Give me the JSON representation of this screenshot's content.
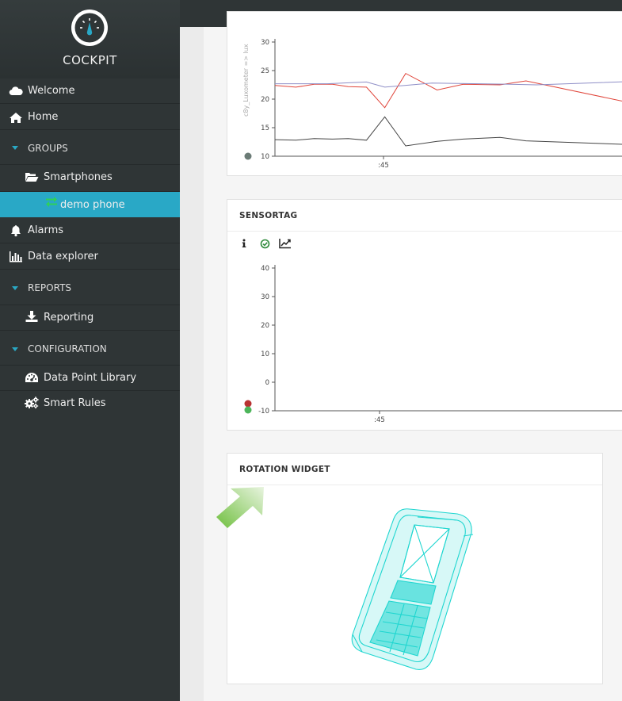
{
  "app": {
    "name": "COCKPIT",
    "logo_icon": "gauge-icon",
    "accent": "#29a8c6"
  },
  "sidebar": {
    "items": [
      {
        "label": "Welcome",
        "icon": "cloud-icon"
      },
      {
        "label": "Home",
        "icon": "home-icon"
      },
      {
        "label": "GROUPS",
        "icon": "caret-down-icon"
      },
      {
        "label": "Smartphones",
        "icon": "folder-open-icon"
      },
      {
        "label": "demo phone",
        "icon": "exchange-icon",
        "active": true
      },
      {
        "label": "Alarms",
        "icon": "bell-icon"
      },
      {
        "label": "Data explorer",
        "icon": "bar-chart-icon"
      },
      {
        "label": "REPORTS",
        "icon": "caret-down-icon"
      },
      {
        "label": "Reporting",
        "icon": "download-icon"
      },
      {
        "label": "CONFIGURATION",
        "icon": "caret-down-icon"
      },
      {
        "label": "Data Point Library",
        "icon": "dashboard-icon"
      },
      {
        "label": "Smart Rules",
        "icon": "cogs-icon"
      }
    ]
  },
  "widgets": {
    "luxometer": {
      "y_axis_title": "c8y_Luxometer => lux",
      "legend_dot_color": "#6b7b76"
    },
    "sensortag": {
      "title": "SENSORTAG",
      "toolbar": [
        "info-icon",
        "check-circle-icon",
        "line-chart-icon"
      ],
      "legend_dot_colors": [
        "#b83232",
        "#4cb55a"
      ]
    },
    "rotation": {
      "title": "ROTATION WIDGET",
      "model_color": "#1fd6d0",
      "arrow_icon": "green-arrow-icon"
    }
  },
  "chart_data": [
    {
      "type": "line",
      "ylabel": "c8y_Luxometer => lux",
      "ylim": [
        10,
        30
      ],
      "yticks": [
        "10",
        "15",
        "20",
        "25",
        "30"
      ],
      "xticks": [
        ":45"
      ],
      "series": [
        {
          "color": "#e0453a",
          "points": [
            [
              0,
              22.4
            ],
            [
              0.08,
              22.1
            ],
            [
              0.15,
              22.6
            ],
            [
              0.22,
              22.6
            ],
            [
              0.28,
              22.2
            ],
            [
              0.35,
              22.1
            ],
            [
              0.42,
              18.5
            ],
            [
              0.5,
              24.5
            ],
            [
              0.62,
              21.6
            ],
            [
              0.72,
              22.6
            ],
            [
              0.86,
              22.5
            ],
            [
              0.96,
              23.2
            ],
            [
              1.5,
              18
            ]
          ]
        },
        {
          "color": "#8f8fc7",
          "points": [
            [
              0,
              22.7
            ],
            [
              0.2,
              22.7
            ],
            [
              0.35,
              23.0
            ],
            [
              0.42,
              22.1
            ],
            [
              0.6,
              22.8
            ],
            [
              0.9,
              22.6
            ],
            [
              1.0,
              22.5
            ],
            [
              1.5,
              23.3
            ]
          ]
        },
        {
          "color": "#444444",
          "points": [
            [
              0,
              12.9
            ],
            [
              0.08,
              12.8
            ],
            [
              0.15,
              13.1
            ],
            [
              0.22,
              13.0
            ],
            [
              0.28,
              13.1
            ],
            [
              0.35,
              12.8
            ],
            [
              0.42,
              16.9
            ],
            [
              0.5,
              11.8
            ],
            [
              0.62,
              12.6
            ],
            [
              0.72,
              13.0
            ],
            [
              0.86,
              13.3
            ],
            [
              0.96,
              12.7
            ],
            [
              1.5,
              11.8
            ]
          ]
        }
      ]
    },
    {
      "type": "line",
      "ylim": [
        -10,
        40
      ],
      "yticks": [
        "-10",
        "0",
        "10",
        "20",
        "30",
        "40"
      ],
      "xticks": [
        ":45"
      ],
      "series": []
    }
  ]
}
